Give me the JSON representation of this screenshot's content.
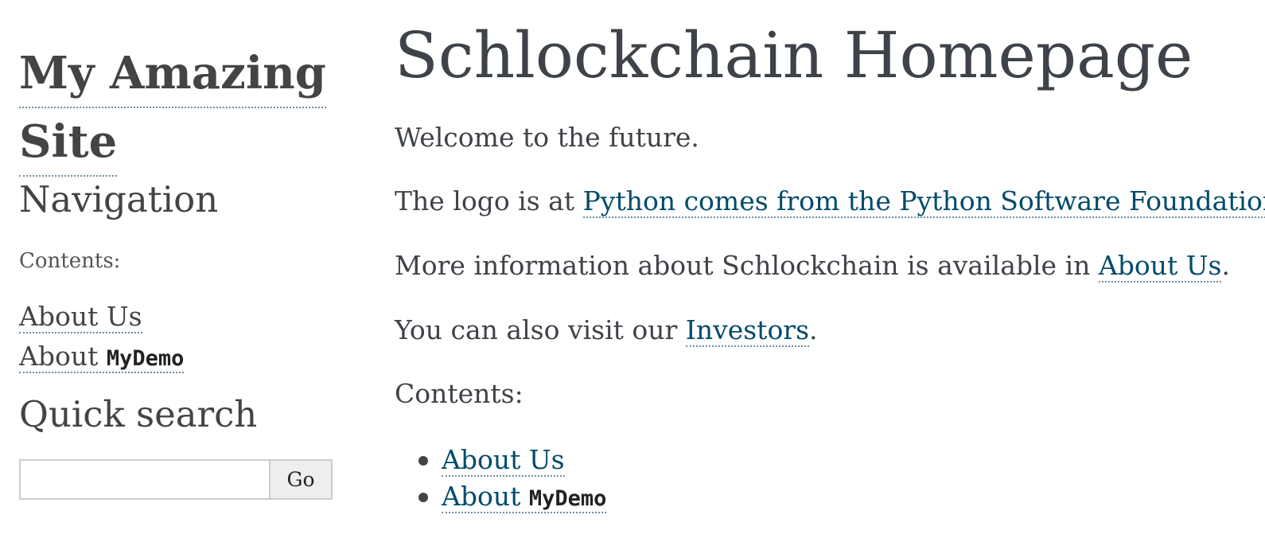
{
  "sidebar": {
    "site_title_line1": "My Amazing",
    "site_title_line2": "Site",
    "navigation_heading": "Navigation",
    "contents_label": "Contents:",
    "links": [
      {
        "label": "About Us"
      },
      {
        "label_prefix": "About",
        "label_code": "MyDemo"
      }
    ],
    "quick_search_heading": "Quick search",
    "search": {
      "value": "",
      "button_label": "Go"
    }
  },
  "main": {
    "title": "Schlockchain Homepage",
    "paragraphs": {
      "welcome": "Welcome to the future.",
      "logo_prefix": "The logo is at ",
      "logo_link": "Python comes from the Python Software Foundation.",
      "info_prefix": "More information about Schlockchain is available in ",
      "info_link": "About Us",
      "info_suffix": ".",
      "visit_prefix": "You can also visit our ",
      "visit_link": "Investors",
      "visit_suffix": ".",
      "contents_label": "Contents:"
    },
    "contents": [
      {
        "label": "About Us"
      },
      {
        "label_prefix": "About",
        "label_code": "MyDemo"
      }
    ]
  },
  "colors": {
    "text": "#3e4349",
    "sidebar_text": "#444444",
    "link": "#004b6b",
    "dotted_border": "#6f8f9f",
    "input_border": "#cccccc",
    "button_background": "#eeeeee"
  }
}
